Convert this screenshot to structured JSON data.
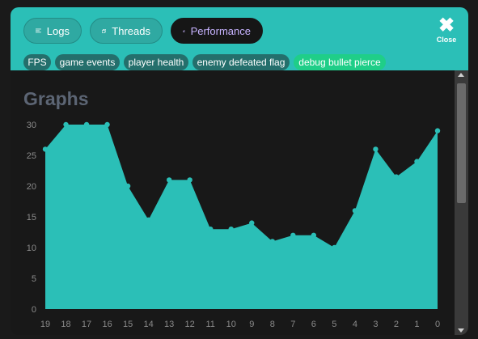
{
  "colors": {
    "header": "#2bbfb7",
    "accent": "#2bbfb7",
    "chip_active": "#1fce88",
    "active_tab_text": "#c7b3ff"
  },
  "tabs": [
    {
      "label": "Logs",
      "icon": "list-icon"
    },
    {
      "label": "Threads",
      "icon": "windows-icon"
    },
    {
      "label": "Performance",
      "icon": "bar-chart-icon",
      "active": true
    }
  ],
  "close": {
    "label": "Close",
    "icon": "close-icon"
  },
  "chips": [
    {
      "label": "FPS",
      "active": false
    },
    {
      "label": "game events",
      "active": false
    },
    {
      "label": "player health",
      "active": false
    },
    {
      "label": "enemy defeated flag",
      "active": false
    },
    {
      "label": "debug bullet pierce",
      "active": true
    }
  ],
  "section": {
    "title": "Graphs"
  },
  "chart_data": {
    "type": "area",
    "title": "",
    "xlabel": "",
    "ylabel": "",
    "x": [
      "19",
      "18",
      "17",
      "16",
      "15",
      "14",
      "13",
      "12",
      "11",
      "10",
      "9",
      "8",
      "7",
      "6",
      "5",
      "4",
      "3",
      "2",
      "1",
      "0"
    ],
    "values": [
      26,
      30,
      30,
      30,
      20,
      14.5,
      21,
      21,
      13,
      13,
      14,
      11,
      12,
      12,
      10,
      16,
      26,
      21.5,
      24,
      29
    ],
    "ylim": [
      0,
      30
    ],
    "yticks": [
      0,
      5,
      10,
      15,
      20,
      25,
      30
    ],
    "grid": false,
    "color": "#2bbfb7"
  }
}
